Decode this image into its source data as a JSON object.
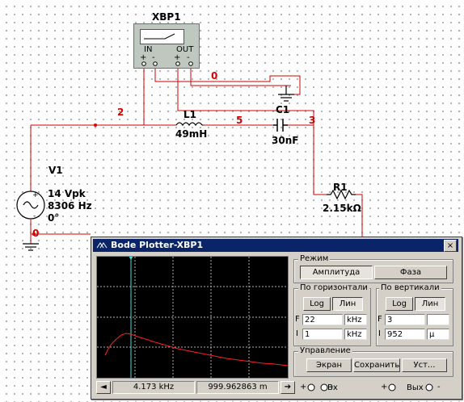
{
  "instrument": {
    "name": "XBP1",
    "pin_in": "IN",
    "pin_out": "OUT",
    "plus": "+",
    "minus": "-"
  },
  "components": {
    "L1": {
      "ref": "L1",
      "value": "49mH"
    },
    "C1": {
      "ref": "C1",
      "value": "30nF"
    },
    "R1": {
      "ref": "R1",
      "value": "2.15kΩ"
    },
    "V1": {
      "ref": "V1",
      "amplitude": "14 Vpk",
      "frequency": "8306 Hz",
      "phase": "0°"
    }
  },
  "nets": {
    "n0_top": "0",
    "n2": "2",
    "n5": "5",
    "n3": "3",
    "n0_bottom": "0"
  },
  "bode": {
    "title": "Bode Plotter-XBP1",
    "close": "×",
    "mode_group": "Режим",
    "amplitude_btn": "Амплитуда",
    "phase_btn": "Фаза",
    "horizontal_group": "По горизонтали",
    "vertical_group": "По вертикали",
    "log_btn": "Log",
    "lin_btn": "Лин",
    "h_final_letter": "F",
    "h_final_value": "22",
    "h_final_unit": "kHz",
    "h_initial_letter": "I",
    "h_initial_value": "1",
    "h_initial_unit": "kHz",
    "v_final_letter": "F",
    "v_final_value": "3",
    "v_final_unit": "",
    "v_initial_letter": "I",
    "v_initial_value": "952",
    "v_initial_unit": "μ",
    "control_group": "Управление",
    "screen_btn": "Экран",
    "save_btn": "Сохранить",
    "setup_btn": "Уст...",
    "cursor_freq": "4.173 kHz",
    "cursor_value": "999.962863 m",
    "left_arrow": "◄",
    "right_arrow": "➔",
    "in_label": "Вх",
    "out_label": "Вых"
  },
  "colors": {
    "wire": "#d20000",
    "trace": "#ff2020",
    "cursor": "#40e0e0",
    "titlebar": "#0a246a"
  }
}
